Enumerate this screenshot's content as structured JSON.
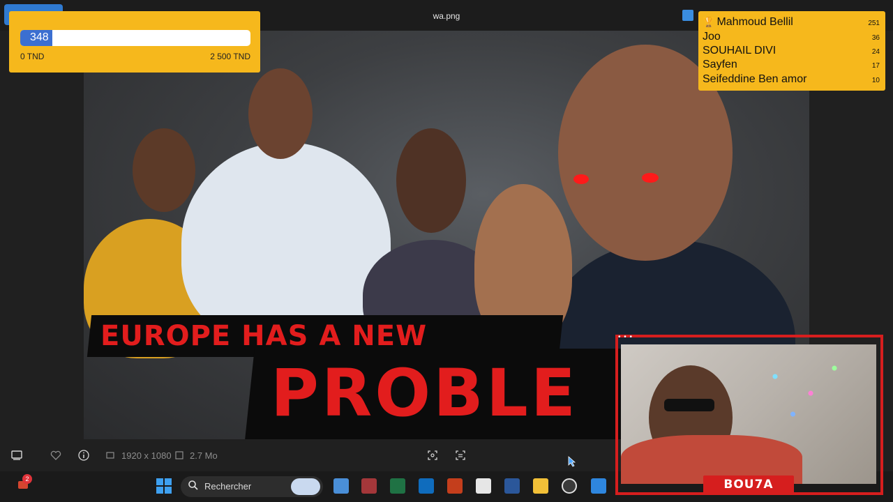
{
  "window": {
    "title": "wa.png"
  },
  "thumbnail": {
    "headline_line1": "EUROPE HAS A NEW",
    "headline_line2": "PROBLE"
  },
  "goal_widget": {
    "current": "348",
    "progress_fraction": 0.1392,
    "min_label": "0 TND",
    "max_label": "2 500 TND"
  },
  "leaderboard": {
    "entries": [
      {
        "name": "Mahmoud Bellil",
        "amount": "251"
      },
      {
        "name": "Joo",
        "amount": "36"
      },
      {
        "name": "SOUHAIL DIVI",
        "amount": "24"
      },
      {
        "name": "Sayfen",
        "amount": "17"
      },
      {
        "name": "Seifeddine Ben amor",
        "amount": "10"
      }
    ]
  },
  "viewer_toolbar": {
    "dimensions": "1920 x 1080",
    "file_size": "2.7 Mo"
  },
  "taskbar": {
    "search_placeholder": "Rechercher",
    "notification_count": "2"
  },
  "webcam": {
    "brand_label": "BOU7A"
  },
  "colors": {
    "accent_yellow": "#f6b81c",
    "progress_blue": "#3b6fd1",
    "headline_red": "#e21d1d",
    "cam_frame_red": "#d61e1e"
  }
}
